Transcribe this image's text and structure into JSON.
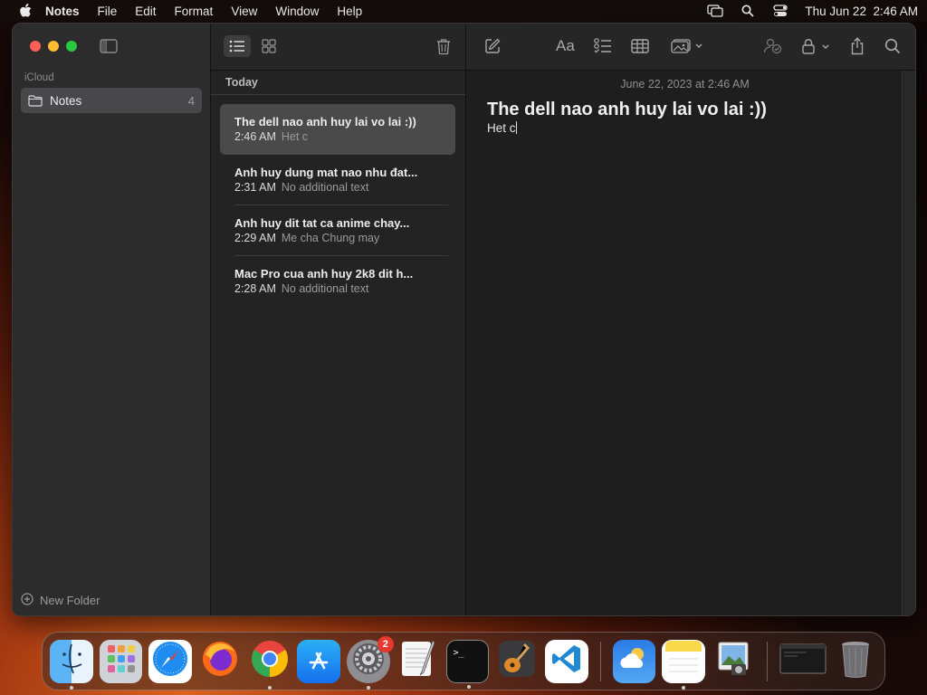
{
  "menubar": {
    "app_name": "Notes",
    "menus": [
      "File",
      "Edit",
      "Format",
      "View",
      "Window",
      "Help"
    ],
    "clock": "Thu Jun 22  2:46 AM"
  },
  "sidebar": {
    "section_label": "iCloud",
    "folder": {
      "name": "Notes",
      "count": "4"
    },
    "new_folder_label": "New Folder"
  },
  "list": {
    "group_label": "Today",
    "notes": [
      {
        "title": "The dell nao anh huy lai vo lai :))",
        "time": "2:46 AM",
        "preview": "Het c"
      },
      {
        "title": "Anh huy dung mat nao nhu đat...",
        "time": "2:31 AM",
        "preview": "No additional text"
      },
      {
        "title": "Anh huy dit tat ca anime chay...",
        "time": "2:29 AM",
        "preview": "Me cha Chung may"
      },
      {
        "title": "Mac Pro cua anh huy 2k8 dit h...",
        "time": "2:28 AM",
        "preview": "No additional text"
      }
    ]
  },
  "editor": {
    "date": "June 22, 2023 at 2:46 AM",
    "title": "The dell nao anh huy lai vo lai :))",
    "body": "Het c",
    "format_label": "Aa"
  },
  "dock": {
    "apps": [
      "finder",
      "launchpad",
      "safari",
      "firefox",
      "chrome",
      "app-store",
      "system-settings",
      "textedit",
      "terminal",
      "garageband",
      "vscode",
      "weather",
      "notes",
      "preview",
      "window-thumbnail",
      "trash"
    ],
    "settings_badge": "2",
    "terminal_prompt": ">_"
  },
  "colors": {
    "window_bg": "#1e1e1e",
    "sidebar_bg": "#2d2c2c",
    "selected_note": "#4a4a4a",
    "badge": "#e8382d"
  }
}
